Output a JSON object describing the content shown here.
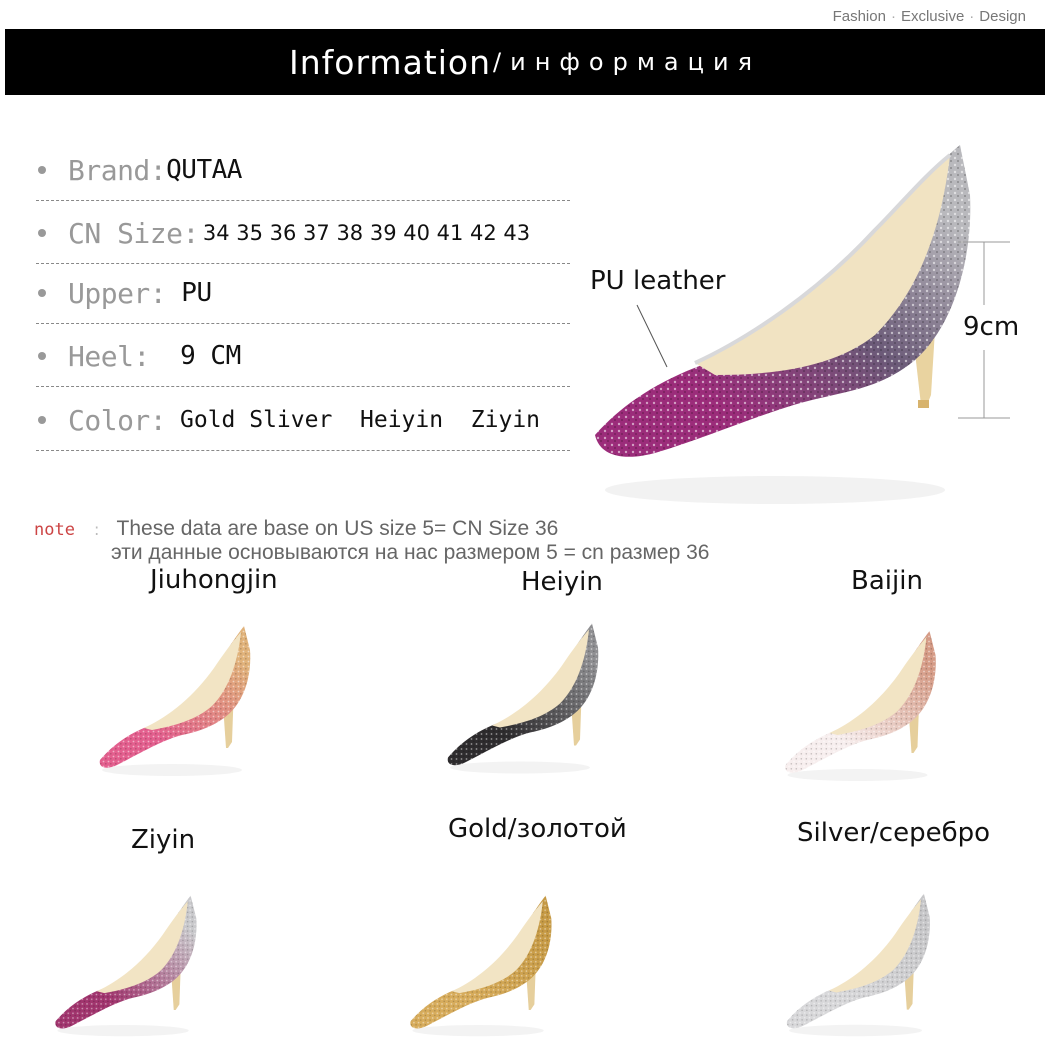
{
  "tagline": {
    "part1": "Fashion",
    "part2": "Exclusive",
    "part3": "Design",
    "separator": "·"
  },
  "banner": {
    "title_en": "Information",
    "title_ru": "/информация"
  },
  "specs": [
    {
      "label": "Brand:",
      "value": "QUTAA"
    },
    {
      "label": "CN Size:",
      "value": "34 35 36 37 38 39 40 41 42 43"
    },
    {
      "label": "Upper:",
      "value": " PU"
    },
    {
      "label": "Heel:",
      "value": "  9 CM"
    },
    {
      "label": "Color:",
      "value": " Gold Sliver  Heiyin  Ziyin"
    }
  ],
  "hero": {
    "material_label": "PU leather",
    "heel_height": "9cm"
  },
  "note": {
    "word": "note",
    "colon": ":",
    "line1": "These data are base on US size 5= CN Size 36",
    "line2": "эти данные основываются на нас размером 5 = cn размер 36"
  },
  "variants": [
    {
      "name": "Jiuhongjin",
      "top": "#e0b27a",
      "bottom": "#e35f8e"
    },
    {
      "name": "Heiyin",
      "top": "#8f8f92",
      "bottom": "#2e2c2e"
    },
    {
      "name": "Baijin",
      "top": "#d59b86",
      "bottom": "#f7eeee"
    },
    {
      "name": "Ziyin",
      "top": "#c9c9cc",
      "bottom": "#a1356e"
    },
    {
      "name": "Gold/золотой",
      "top": "#c69a45",
      "bottom": "#d7ac5c"
    },
    {
      "name": "Silver/серебро",
      "top": "#c7c7c9",
      "bottom": "#d8d8da"
    }
  ],
  "colors": {
    "banner_bg": "#000000",
    "hero_top": "#b9b9bd",
    "hero_bottom": "#9b2c7a",
    "note_accent": "#cc4444"
  }
}
